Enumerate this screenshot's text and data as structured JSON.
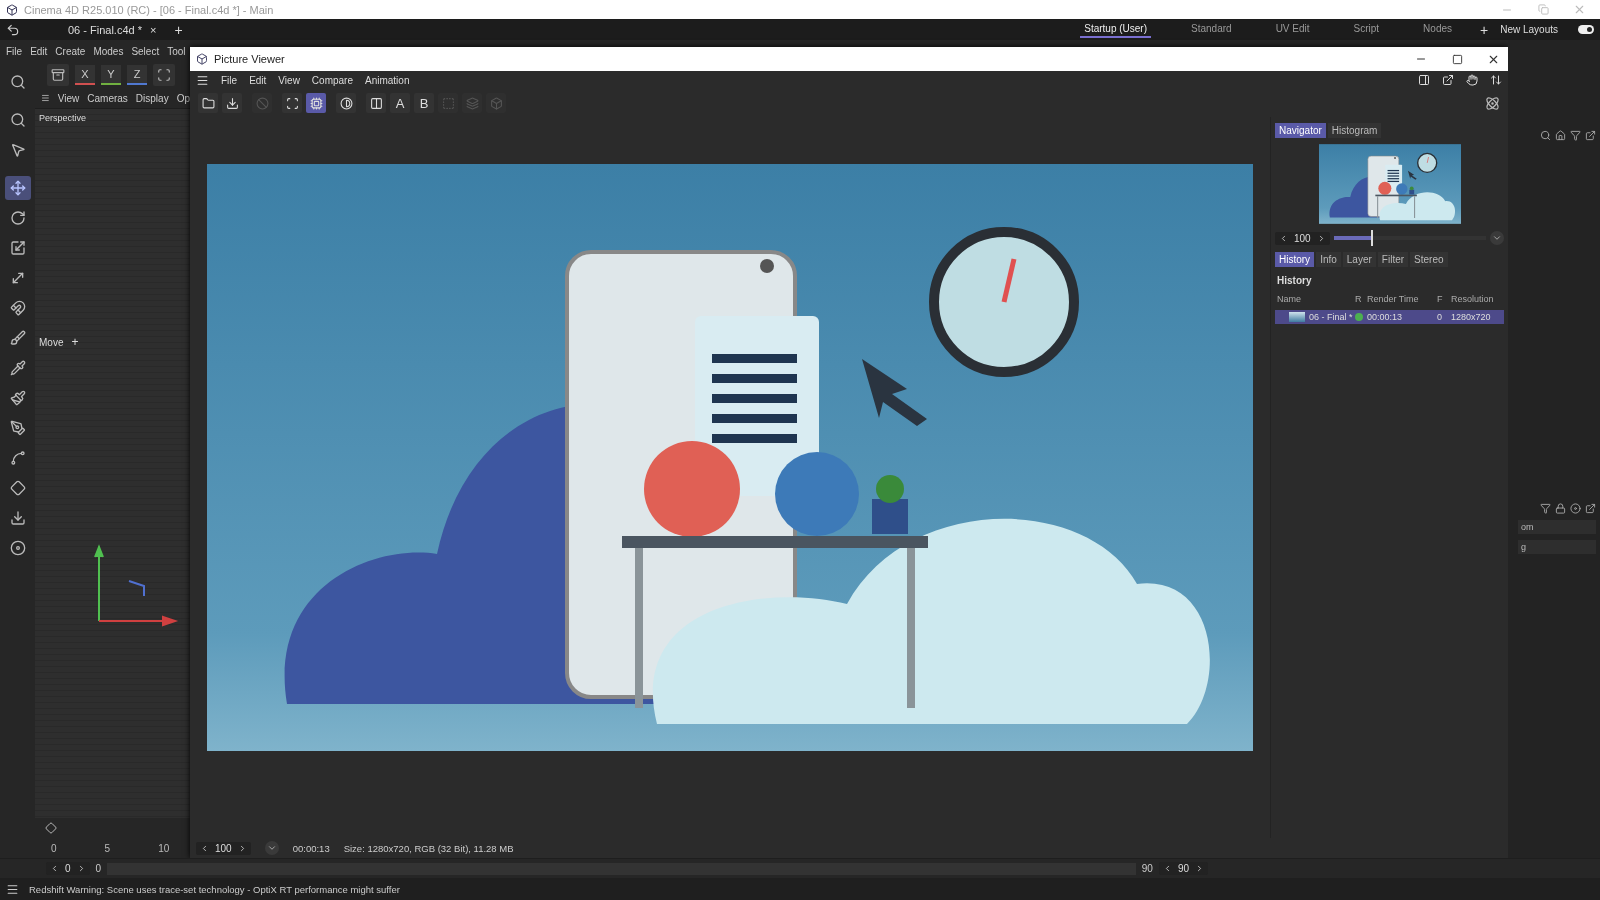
{
  "app_title": "Cinema 4D R25.010 (RC) - [06 - Final.c4d *] - Main",
  "doc_tab": {
    "label": "06 - Final.c4d *",
    "close": "×"
  },
  "add_tab": "+",
  "layouts": [
    {
      "label": "Startup (User)",
      "selected": true
    },
    {
      "label": "Standard",
      "selected": false
    },
    {
      "label": "UV Edit",
      "selected": false
    },
    {
      "label": "Script",
      "selected": false
    },
    {
      "label": "Nodes",
      "selected": false
    }
  ],
  "add_layout": "+",
  "new_layouts": {
    "label": "New Layouts",
    "on": true
  },
  "main_menu": [
    "File",
    "Edit",
    "Create",
    "Modes",
    "Select",
    "Tool"
  ],
  "axis_buttons": [
    {
      "label": "X",
      "color": "#d05050"
    },
    {
      "label": "Y",
      "color": "#70b040"
    },
    {
      "label": "Z",
      "color": "#5078d0"
    }
  ],
  "viewport": {
    "menu": [
      "View",
      "Cameras",
      "Display",
      "Op"
    ],
    "camera": "Perspective",
    "tool_label": "Move",
    "tool_plus": "+"
  },
  "tools": [
    {
      "selected": false
    },
    {
      "selected": false
    },
    {
      "selected": false
    },
    {
      "selected": true
    },
    {
      "selected": false
    },
    {
      "selected": false
    },
    {
      "selected": false
    },
    {
      "selected": false
    },
    {
      "selected": false
    },
    {
      "selected": false
    },
    {
      "selected": false
    },
    {
      "selected": false
    },
    {
      "selected": false
    },
    {
      "selected": false
    },
    {
      "selected": false
    },
    {
      "selected": false
    }
  ],
  "timeline": {
    "ruler": [
      "0",
      "5",
      "10"
    ],
    "start_field": "0",
    "start_value": "0",
    "end_value": "90",
    "end_field": "90"
  },
  "viewer": {
    "title": "Picture Viewer",
    "menu": [
      "File",
      "Edit",
      "View",
      "Compare",
      "Animation"
    ],
    "toolbar": [
      {
        "kind": "icon",
        "selected": false,
        "disabled": false
      },
      {
        "kind": "icon",
        "selected": false,
        "disabled": false
      },
      {
        "kind": "icon",
        "selected": false,
        "disabled": true
      },
      {
        "kind": "icon",
        "selected": false,
        "disabled": false
      },
      {
        "kind": "icon",
        "selected": true,
        "disabled": false
      },
      {
        "kind": "icon",
        "selected": false,
        "disabled": false
      },
      {
        "kind": "icon",
        "selected": false,
        "disabled": false
      },
      {
        "kind": "text",
        "label": "A",
        "selected": false,
        "disabled": false
      },
      {
        "kind": "text",
        "label": "B",
        "selected": false,
        "disabled": false
      },
      {
        "kind": "icon",
        "selected": false,
        "disabled": true
      },
      {
        "kind": "icon",
        "selected": false,
        "disabled": true
      },
      {
        "kind": "icon",
        "selected": false,
        "disabled": true
      }
    ],
    "status": {
      "zoom": "100",
      "time": "00:00:13",
      "info": "Size: 1280x720, RGB (32 Bit), 11.28 MB"
    }
  },
  "side_panel": {
    "top_tabs": [
      {
        "label": "Navigator",
        "selected": true
      },
      {
        "label": "Histogram",
        "selected": false
      }
    ],
    "zoom": "100",
    "zoom_slider": {
      "level": 0.25
    },
    "tabs": [
      {
        "label": "History",
        "selected": true
      },
      {
        "label": "Info",
        "selected": false
      },
      {
        "label": "Layer",
        "selected": false
      },
      {
        "label": "Filter",
        "selected": false
      },
      {
        "label": "Stereo",
        "selected": false
      }
    ],
    "section": "History",
    "columns": [
      "Name",
      "R",
      "Render Time",
      "F",
      "Resolution"
    ],
    "rows": [
      {
        "name": "06 - Final *",
        "color": "#4caf50",
        "time": "00:00:13",
        "frame": "0",
        "resolution": "1280x720",
        "selected": true
      }
    ]
  },
  "right_strip": {
    "fields": [
      "om",
      "g"
    ]
  },
  "status_bar": "Redshift Warning: Scene uses trace-set technology - OptiX RT performance might suffer"
}
